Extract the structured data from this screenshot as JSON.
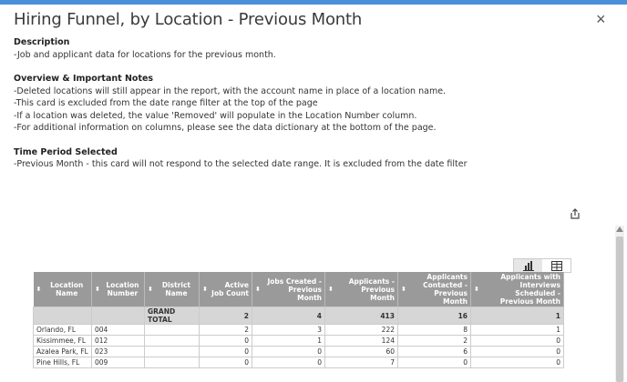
{
  "header": {
    "title": "Hiring Funnel, by Location - Previous Month",
    "close_label": "×"
  },
  "description": {
    "heading": "Description",
    "lines": [
      "-Job and applicant data for locations for the previous month."
    ]
  },
  "overview": {
    "heading": "Overview & Important Notes",
    "lines": [
      "-Deleted locations will still appear in the report, with the account name in place of a location name.",
      "-This card is excluded from the date range filter at the top of the page",
      "-If a location was deleted, the value 'Removed' will populate in the Location Number column.",
      "-For additional information on columns, please see the data dictionary at the bottom of the page."
    ]
  },
  "time_period": {
    "heading": "Time Period Selected",
    "lines": [
      "-Previous Month - this card will not respond to the selected date range. It is excluded from the date filter"
    ]
  },
  "icons": {
    "share": "share-icon",
    "chart_view": "bar-chart-icon",
    "table_view": "table-icon",
    "close": "close-icon",
    "sort": "sort-icon"
  },
  "colors": {
    "accent_bar": "#4a90d9",
    "header_bg": "#9a9a9a",
    "total_bg": "#d6d6d6"
  },
  "table": {
    "columns": [
      {
        "label": "Location Name",
        "sort_left": true,
        "align": "left"
      },
      {
        "label": "Location Number",
        "sort_left": true,
        "align": "left"
      },
      {
        "label": "District Name",
        "sort_left": true,
        "align": "left"
      },
      {
        "label": "Active Job Count",
        "sort_left": false,
        "align": "right"
      },
      {
        "label": "Jobs Created - Previous Month",
        "sort_left": true,
        "align": "right"
      },
      {
        "label": "Applicants - Previous Month",
        "sort_left": true,
        "align": "right"
      },
      {
        "label": "Applicants Contacted - Previous Month",
        "sort_left": true,
        "align": "right"
      },
      {
        "label": "Applicants with Interviews Scheduled - Previous Month",
        "sort_left": true,
        "align": "right"
      }
    ],
    "total": [
      "",
      "",
      "GRAND TOTAL",
      "2",
      "4",
      "413",
      "16",
      "1"
    ],
    "rows": [
      [
        "Orlando, FL",
        "004",
        "",
        "2",
        "3",
        "222",
        "8",
        "1"
      ],
      [
        "Kissimmee, FL",
        "012",
        "",
        "0",
        "1",
        "124",
        "2",
        "0"
      ],
      [
        "Azalea Park, FL",
        "023",
        "",
        "0",
        "0",
        "60",
        "6",
        "0"
      ],
      [
        "Pine Hills, FL",
        "009",
        "",
        "0",
        "0",
        "7",
        "0",
        "0"
      ]
    ]
  }
}
